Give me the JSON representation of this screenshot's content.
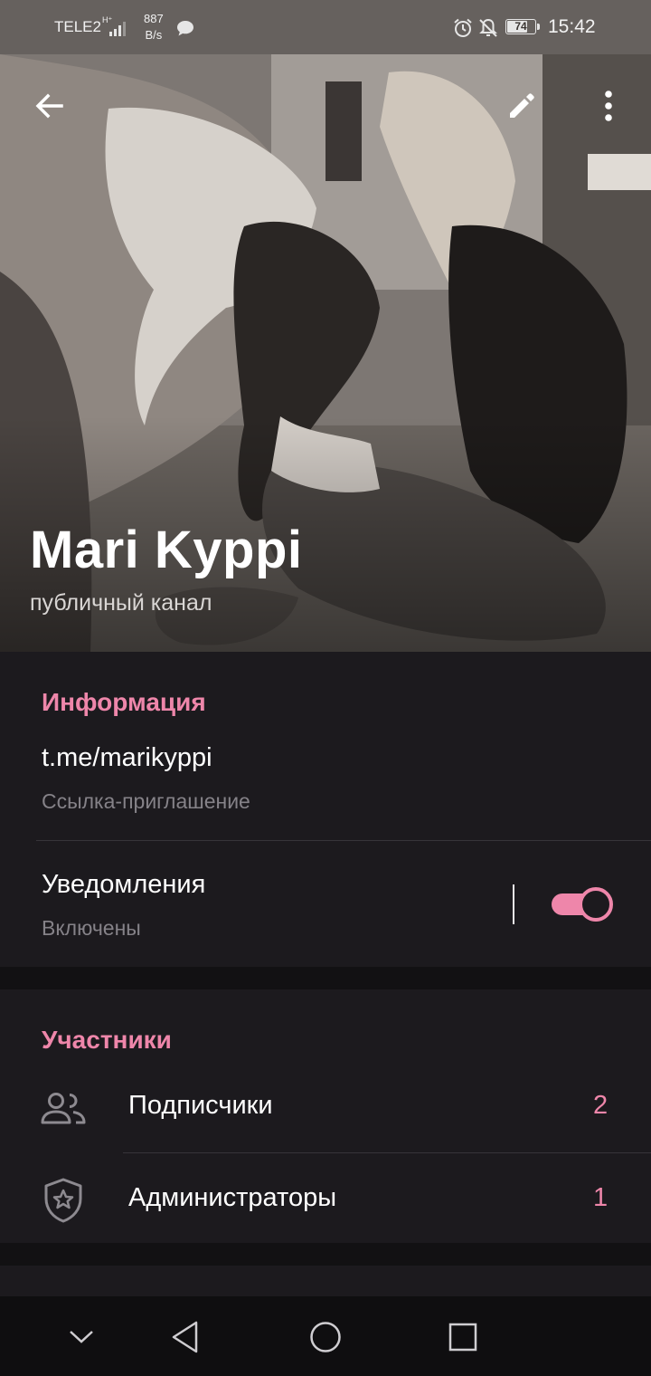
{
  "status_bar": {
    "carrier": "TELE2",
    "network_type": "H⁺",
    "speed_value": "887",
    "speed_unit": "B/s",
    "battery_level": 74,
    "battery_text": "74",
    "time": "15:42",
    "icons": [
      "signal-icon",
      "chat-icon",
      "alarm-icon",
      "bell-off-icon",
      "battery-icon"
    ]
  },
  "header": {
    "channel_name": "Mari Kyppi",
    "channel_type": "публичный канал",
    "actions": [
      "back-arrow-icon",
      "pencil-icon",
      "more-vert-icon"
    ]
  },
  "info": {
    "title": "Информация",
    "link": "t.me/marikyppi",
    "link_label": "Ссылка-приглашение",
    "notifications_title": "Уведомления",
    "notifications_status": "Включены",
    "notifications_enabled": true
  },
  "members": {
    "title": "Участники",
    "items": [
      {
        "icon": "people-icon",
        "label": "Подписчики",
        "count": "2"
      },
      {
        "icon": "shield-star-icon",
        "label": "Администраторы",
        "count": "1"
      }
    ]
  },
  "nav": [
    "chevron-down-icon",
    "back-triangle-icon",
    "home-circle-icon",
    "recents-square-icon"
  ],
  "colors": {
    "accent": "#ee86aa",
    "background": "#1c1a1e",
    "section_gap": "#121113",
    "secondary_text": "#858288"
  }
}
